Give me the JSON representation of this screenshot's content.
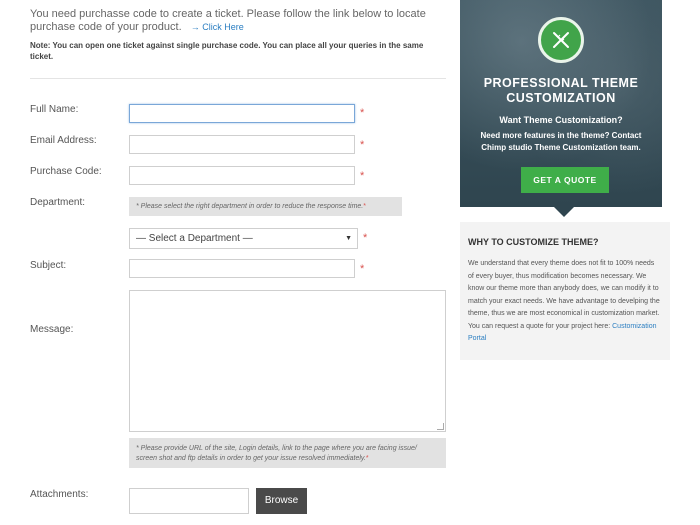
{
  "intro": {
    "text": "You need purchasse code to create a ticket. Please follow the link below to locate purchase code of your product.",
    "link_arrow": "→",
    "link_label": "Click Here",
    "note": "Note: You can open one ticket against single purchase code. You can place all your queries in the same ticket."
  },
  "form": {
    "full_name_label": "Full Name:",
    "email_label": "Email Address:",
    "purchase_label": "Purchase Code:",
    "department_label": "Department:",
    "department_hint": "* Please select the right department in order to reduce the response time.",
    "department_hint_star": "*",
    "department_selected": "— Select a Department —",
    "subject_label": "Subject:",
    "message_label": "Message:",
    "message_hint": "* Please provide URL of the site, Login details, link to the page where you are facing issue/ screen shot and ftp details in order to get your issue resolved immediately.",
    "message_hint_star": "*",
    "attachments_label": "Attachments:",
    "browse_label": "Browse",
    "required_mark": "*"
  },
  "promo": {
    "title": "PROFESSIONAL THEME CUSTOMIZATION",
    "subtitle": "Want Theme Customization?",
    "description": "Need more features in the theme? Contact Chimp studio Theme Customization team.",
    "button_label": "GET A QUOTE",
    "icon": "pencil-ruler-icon",
    "accent_color": "#3fae49"
  },
  "why": {
    "title": "WHY TO CUSTOMIZE THEME?",
    "text": "We understand that every theme does not fit to 100% needs of every buyer, thus modification becomes necessary. We know our theme more than anybody does, we can modify it to match your exact needs. We have advantage to develping the theme, thus we are most economical in customization market. You can request a quote for your project here:",
    "link_label": "Customization Portal"
  }
}
